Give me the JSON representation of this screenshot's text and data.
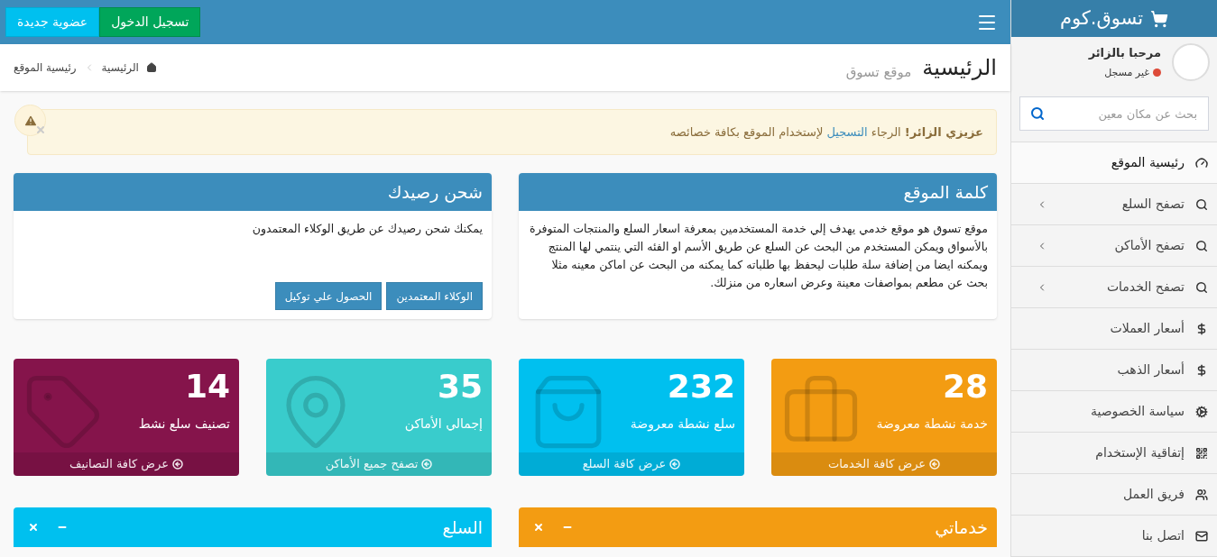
{
  "sidebar": {
    "logo": "تسوق.كوم",
    "user": {
      "name": "مرحبا بالزائر",
      "status": {
        "text": "غير مسجل",
        "color": "#dd4b39"
      }
    },
    "search": {
      "placeholder": "بحث عن مكان معين"
    },
    "menu": [
      {
        "label": "رئيسية الموقع",
        "kind": "dashboard",
        "selected": true,
        "expandable": false
      },
      {
        "label": "تصفح السلع",
        "kind": "search",
        "selected": false,
        "expandable": true
      },
      {
        "label": "تصفح الأماكن",
        "kind": "search",
        "selected": false,
        "expandable": true
      },
      {
        "label": "تصفح الخدمات",
        "kind": "search",
        "selected": false,
        "expandable": true
      },
      {
        "label": "أسعار العملات",
        "kind": "dollar",
        "selected": false,
        "expandable": false
      },
      {
        "label": "أسعار الذهب",
        "kind": "dollar",
        "selected": false,
        "expandable": false
      },
      {
        "label": "سياسة الخصوصية",
        "kind": "gears",
        "selected": false,
        "expandable": false
      },
      {
        "label": "إتفاقية الإستخدام",
        "kind": "qrcode",
        "selected": false,
        "expandable": false
      },
      {
        "label": "فريق العمل",
        "kind": "users",
        "selected": false,
        "expandable": false
      },
      {
        "label": "اتصل بنا",
        "kind": "mail",
        "selected": false,
        "expandable": false
      }
    ]
  },
  "topbar": {
    "buttons": [
      {
        "label": "تسجيل الدخول",
        "kind": "login"
      },
      {
        "label": "عضوية جديدة",
        "kind": "register"
      }
    ]
  },
  "page_header": {
    "title": "الرئيسية",
    "subtitle": "موقع تسوق",
    "breadcrumb": [
      "الرئيسية",
      "رئيسية الموقع"
    ]
  },
  "alert": {
    "message_start": "**عزيزي الزائر!** الرجاء",
    "link": "التسجيل",
    "message_end": "لإستخدام الموقع بكافة خصائصه"
  },
  "boxes": [
    {
      "title": "كلمة الموقع",
      "body": "موقع تسوق هو موقع خدمي يهدف إلي خدمة المستخدمين بمعرفة اسعار السلع والمنتجات المتوفرة بالأسواق ويمكن المستخدم من البحث عن السلع عن طريق الأسم او الفئه التي ينتمي لها المنتج ويمكنه ايضا من إضافة سلة طلبات ليحفظ بها طلباته كما يمكنه من البحث عن اماكن معينه مثلا بحث عن مطعم بمواصفات معينة وعرض اسعاره من منزلك."
    },
    {
      "title": "شحن رصيدك",
      "body": "يمكنك شحن رصيدك عن طريق الوكلاء المعتمدون",
      "buttons": [
        "الوكلاء المعتمدين",
        "الحصول علي توكيل"
      ]
    }
  ],
  "stats": [
    {
      "value": "28",
      "label": "خدمة نشطة معروضة",
      "link": "عرض كافة الخدمات",
      "kind": "briefcase",
      "color": "#f39c12"
    },
    {
      "value": "232",
      "label": "سلع نشطة معروضة",
      "link": "عرض كافة السلع",
      "kind": "bag",
      "color": "#00c0ef"
    },
    {
      "value": "35",
      "label": "إجمالي الأماكن",
      "link": "تصفح جميع الأماكن",
      "kind": "pin",
      "color": "#39cccc"
    },
    {
      "value": "14",
      "label": "تصنيف سلع نشط",
      "link": "عرض كافة التصانيف",
      "kind": "tag",
      "color": "#85144b"
    }
  ],
  "panels": [
    {
      "title": "خدماتي",
      "color": "#f39c12"
    },
    {
      "title": "السلع",
      "color": "#00c0ef"
    }
  ]
}
